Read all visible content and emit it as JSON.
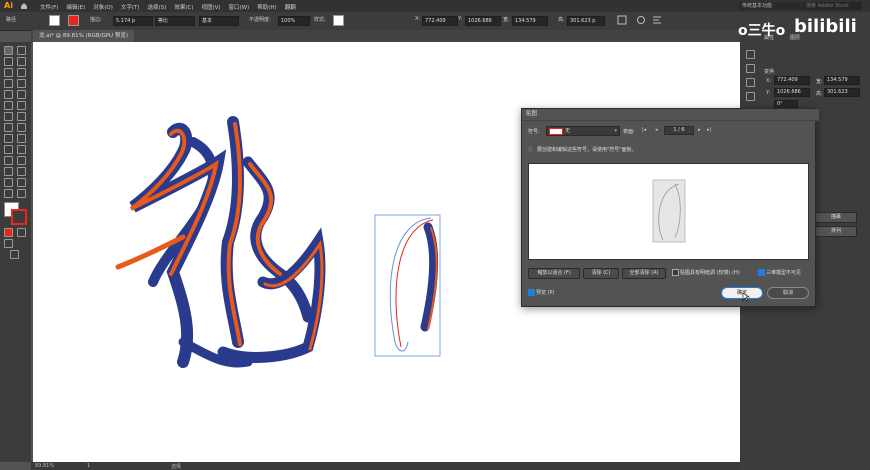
{
  "app": {
    "logo": "Ai",
    "home_icon": "home-icon"
  },
  "menu": [
    "文件(F)",
    "编辑(E)",
    "对象(O)",
    "文字(T)",
    "选择(S)",
    "效果(C)",
    "视图(V)",
    "窗口(W)",
    "帮助(H)",
    "翻翻"
  ],
  "workspace": "传统基本功能",
  "search_placeholder": "搜索 Adobe Stock",
  "control": {
    "label_path": "路径",
    "stroke_label": "描边:",
    "stroke_value": "5.174 p",
    "profile_label": "等比",
    "brush_label": "基本",
    "opacity_label": "不透明度:",
    "opacity_value": "100%",
    "style_label": "样式:",
    "x_label": "X:",
    "x_value": "772.409",
    "y_label": "Y:",
    "y_value": "1026.686",
    "w_label": "宽:",
    "w_value": "134.579",
    "h_label": "高:",
    "h_value": "301.623 p"
  },
  "document_tab": "龙.ai* @ 89.81% (RGB/GPU 预览)",
  "status": {
    "zoom": "89.81%",
    "page": "1",
    "tool": "选择"
  },
  "right_panel": {
    "tab1": "属性",
    "tab2": "图层",
    "section_transform": "变换",
    "x_label": "X:",
    "x_value": "772.409",
    "y_label": "Y:",
    "y_value": "1026.686",
    "w_label": "宽:",
    "w_value": "134.579",
    "h_label": "高:",
    "h_value": "301.623",
    "angle_value": "0°",
    "btn_a": "描摹",
    "btn_b": "排列"
  },
  "watermark": {
    "left": "o三牛o",
    "right": "bilibili"
  },
  "dialog": {
    "title": "贴图",
    "symbol_label": "符号:",
    "symbol_value": "无",
    "surface_label": "表面:",
    "page_value": "1 / 6",
    "info": "要创建和编辑这些符号，请使用\"符号\"面板。",
    "btn_fit": "缩放以适合 (F)",
    "btn_clear": "清除 (C)",
    "btn_clear_all": "全部清除 (A)",
    "shade_label": "贴图具有明暗调 (较慢) (H)",
    "shade_checked": false,
    "invisible_label": "三维模型不可见",
    "invisible_checked": true,
    "preview_label": "预览 (P)",
    "preview_checked": true,
    "ok": "确定",
    "cancel": "取消"
  },
  "colors": {
    "accent": "#1e7ed8",
    "stroke_red": "#e8261c",
    "brush_blue": "#2a3a8c",
    "brush_orange": "#e85a1a"
  }
}
